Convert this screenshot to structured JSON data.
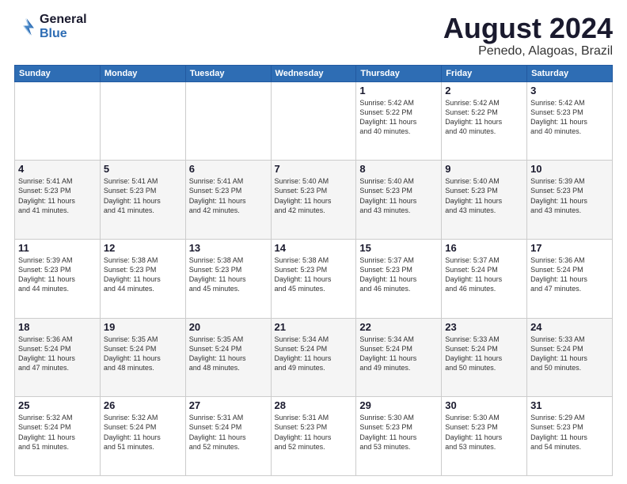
{
  "header": {
    "logo_general": "General",
    "logo_blue": "Blue",
    "month_title": "August 2024",
    "location": "Penedo, Alagoas, Brazil"
  },
  "weekdays": [
    "Sunday",
    "Monday",
    "Tuesday",
    "Wednesday",
    "Thursday",
    "Friday",
    "Saturday"
  ],
  "weeks": [
    [
      {
        "day": "",
        "info": ""
      },
      {
        "day": "",
        "info": ""
      },
      {
        "day": "",
        "info": ""
      },
      {
        "day": "",
        "info": ""
      },
      {
        "day": "1",
        "info": "Sunrise: 5:42 AM\nSunset: 5:22 PM\nDaylight: 11 hours\nand 40 minutes."
      },
      {
        "day": "2",
        "info": "Sunrise: 5:42 AM\nSunset: 5:22 PM\nDaylight: 11 hours\nand 40 minutes."
      },
      {
        "day": "3",
        "info": "Sunrise: 5:42 AM\nSunset: 5:23 PM\nDaylight: 11 hours\nand 40 minutes."
      }
    ],
    [
      {
        "day": "4",
        "info": "Sunrise: 5:41 AM\nSunset: 5:23 PM\nDaylight: 11 hours\nand 41 minutes."
      },
      {
        "day": "5",
        "info": "Sunrise: 5:41 AM\nSunset: 5:23 PM\nDaylight: 11 hours\nand 41 minutes."
      },
      {
        "day": "6",
        "info": "Sunrise: 5:41 AM\nSunset: 5:23 PM\nDaylight: 11 hours\nand 42 minutes."
      },
      {
        "day": "7",
        "info": "Sunrise: 5:40 AM\nSunset: 5:23 PM\nDaylight: 11 hours\nand 42 minutes."
      },
      {
        "day": "8",
        "info": "Sunrise: 5:40 AM\nSunset: 5:23 PM\nDaylight: 11 hours\nand 43 minutes."
      },
      {
        "day": "9",
        "info": "Sunrise: 5:40 AM\nSunset: 5:23 PM\nDaylight: 11 hours\nand 43 minutes."
      },
      {
        "day": "10",
        "info": "Sunrise: 5:39 AM\nSunset: 5:23 PM\nDaylight: 11 hours\nand 43 minutes."
      }
    ],
    [
      {
        "day": "11",
        "info": "Sunrise: 5:39 AM\nSunset: 5:23 PM\nDaylight: 11 hours\nand 44 minutes."
      },
      {
        "day": "12",
        "info": "Sunrise: 5:38 AM\nSunset: 5:23 PM\nDaylight: 11 hours\nand 44 minutes."
      },
      {
        "day": "13",
        "info": "Sunrise: 5:38 AM\nSunset: 5:23 PM\nDaylight: 11 hours\nand 45 minutes."
      },
      {
        "day": "14",
        "info": "Sunrise: 5:38 AM\nSunset: 5:23 PM\nDaylight: 11 hours\nand 45 minutes."
      },
      {
        "day": "15",
        "info": "Sunrise: 5:37 AM\nSunset: 5:23 PM\nDaylight: 11 hours\nand 46 minutes."
      },
      {
        "day": "16",
        "info": "Sunrise: 5:37 AM\nSunset: 5:24 PM\nDaylight: 11 hours\nand 46 minutes."
      },
      {
        "day": "17",
        "info": "Sunrise: 5:36 AM\nSunset: 5:24 PM\nDaylight: 11 hours\nand 47 minutes."
      }
    ],
    [
      {
        "day": "18",
        "info": "Sunrise: 5:36 AM\nSunset: 5:24 PM\nDaylight: 11 hours\nand 47 minutes."
      },
      {
        "day": "19",
        "info": "Sunrise: 5:35 AM\nSunset: 5:24 PM\nDaylight: 11 hours\nand 48 minutes."
      },
      {
        "day": "20",
        "info": "Sunrise: 5:35 AM\nSunset: 5:24 PM\nDaylight: 11 hours\nand 48 minutes."
      },
      {
        "day": "21",
        "info": "Sunrise: 5:34 AM\nSunset: 5:24 PM\nDaylight: 11 hours\nand 49 minutes."
      },
      {
        "day": "22",
        "info": "Sunrise: 5:34 AM\nSunset: 5:24 PM\nDaylight: 11 hours\nand 49 minutes."
      },
      {
        "day": "23",
        "info": "Sunrise: 5:33 AM\nSunset: 5:24 PM\nDaylight: 11 hours\nand 50 minutes."
      },
      {
        "day": "24",
        "info": "Sunrise: 5:33 AM\nSunset: 5:24 PM\nDaylight: 11 hours\nand 50 minutes."
      }
    ],
    [
      {
        "day": "25",
        "info": "Sunrise: 5:32 AM\nSunset: 5:24 PM\nDaylight: 11 hours\nand 51 minutes."
      },
      {
        "day": "26",
        "info": "Sunrise: 5:32 AM\nSunset: 5:24 PM\nDaylight: 11 hours\nand 51 minutes."
      },
      {
        "day": "27",
        "info": "Sunrise: 5:31 AM\nSunset: 5:24 PM\nDaylight: 11 hours\nand 52 minutes."
      },
      {
        "day": "28",
        "info": "Sunrise: 5:31 AM\nSunset: 5:23 PM\nDaylight: 11 hours\nand 52 minutes."
      },
      {
        "day": "29",
        "info": "Sunrise: 5:30 AM\nSunset: 5:23 PM\nDaylight: 11 hours\nand 53 minutes."
      },
      {
        "day": "30",
        "info": "Sunrise: 5:30 AM\nSunset: 5:23 PM\nDaylight: 11 hours\nand 53 minutes."
      },
      {
        "day": "31",
        "info": "Sunrise: 5:29 AM\nSunset: 5:23 PM\nDaylight: 11 hours\nand 54 minutes."
      }
    ]
  ]
}
